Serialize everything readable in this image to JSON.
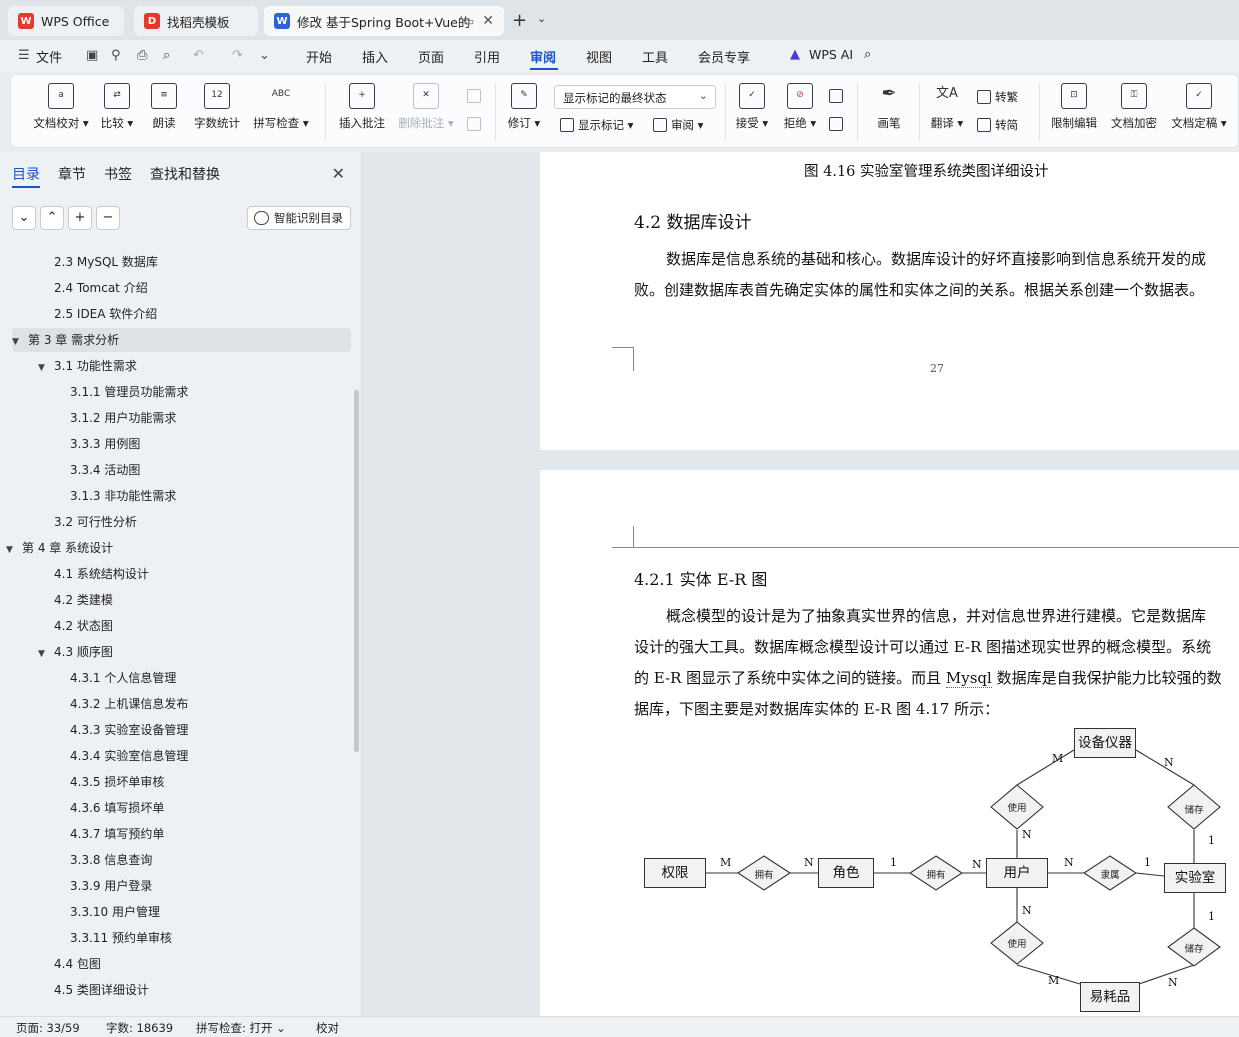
{
  "tabs": [
    {
      "label": "WPS Office",
      "icon": "wps-logo-icon"
    },
    {
      "label": "找稻壳模板",
      "icon": "docer-icon"
    },
    {
      "label": "修改 基于Spring Boot+Vue的",
      "icon": "writer-icon"
    }
  ],
  "menu": {
    "file": "文件",
    "items": [
      "开始",
      "插入",
      "页面",
      "引用",
      "审阅",
      "视图",
      "工具",
      "会员专享"
    ],
    "active": "审阅",
    "ai": "WPS AI"
  },
  "ribbon": {
    "doc_check": "文档校对",
    "compare": "比较",
    "read_aloud": "朗读",
    "word_count": "字数统计",
    "word_count_icon_text": "12",
    "spell_check": "拼写检查",
    "spell_icon_text": "ABC",
    "insert_comment": "插入批注",
    "delete_comment": "删除批注",
    "revise": "修订",
    "markup_combo": "显示标记的最终状态",
    "show_markup": "显示标记",
    "review": "审阅",
    "accept": "接受",
    "reject": "拒绝",
    "pen": "画笔",
    "translate": "翻译",
    "to_traditional": "转繁",
    "to_simplified": "转简",
    "restrict_edit": "限制编辑",
    "encrypt": "文档加密",
    "finalize": "文档定稿"
  },
  "nav": {
    "tabs": [
      "目录",
      "章节",
      "书签",
      "查找和替换"
    ],
    "smart_btn": "智能识别目录",
    "toc": [
      {
        "text": "2.3 MySQL 数据库",
        "level": 2
      },
      {
        "text": "2.4 Tomcat 介绍",
        "level": 2
      },
      {
        "text": "2.5 IDEA 软件介绍",
        "level": 2
      },
      {
        "text": "第 3 章  需求分析",
        "level": 1,
        "expanded": true,
        "selected": true
      },
      {
        "text": "3.1  功能性需求",
        "level": 2,
        "expanded": true
      },
      {
        "text": "3.1.1  管理员功能需求",
        "level": 3
      },
      {
        "text": "3.1.2  用户功能需求",
        "level": 3
      },
      {
        "text": "3.3.3 用例图",
        "level": 3
      },
      {
        "text": "3.3.4 活动图",
        "level": 3
      },
      {
        "text": "3.1.3  非功能性需求",
        "level": 3
      },
      {
        "text": "3.2  可行性分析",
        "level": 2
      },
      {
        "text": "第 4 章  系统设计",
        "level": 1,
        "expanded": true
      },
      {
        "text": "4.1  系统结构设计",
        "level": 2
      },
      {
        "text": "4.2  类建模",
        "level": 2
      },
      {
        "text": "4.2  状态图",
        "level": 2
      },
      {
        "text": "4.3  顺序图",
        "level": 2,
        "expanded": true
      },
      {
        "text": "4.3.1  个人信息管理",
        "level": 3
      },
      {
        "text": "4.3.2 上机课信息发布",
        "level": 3
      },
      {
        "text": "4.3.3 实验室设备管理",
        "level": 3
      },
      {
        "text": "4.3.4 实验室信息管理",
        "level": 3
      },
      {
        "text": "4.3.5 损坏单审核",
        "level": 3
      },
      {
        "text": "4.3.6 填写损坏单",
        "level": 3
      },
      {
        "text": "4.3.7 填写预约单",
        "level": 3
      },
      {
        "text": "3.3.8 信息查询",
        "level": 3
      },
      {
        "text": "3.3.9 用户登录",
        "level": 3
      },
      {
        "text": "3.3.10 用户管理",
        "level": 3
      },
      {
        "text": "3.3.11 预约单审核",
        "level": 3
      },
      {
        "text": "4.4  包图",
        "level": 2
      },
      {
        "text": "4.5 类图详细设计",
        "level": 2
      }
    ]
  },
  "doc": {
    "caption": "图 4.16  实验室管理系统类图详细设计",
    "heading_42": "4.2  数据库设计",
    "para1_line1": "数据库是信息系统的基础和核心。数据库设计的好坏直接影响到信息系统开发的成",
    "para1_line2": "败。创建数据库表首先确定实体的属性和实体之间的关系。根据关系创建一个数据表。",
    "page_number": "27",
    "heading_421": "4.2.1  实体 E-R 图",
    "para2_line1": "概念模型的设计是为了抽象真实世界的信息，并对信息世界进行建模。它是数据库",
    "para2_line2": "设计的强大工具。数据库概念模型设计可以通过 E-R 图描述现实世界的概念模型。系统",
    "para2_line3_a": "的 E-R 图显示了系统中实体之间的链接。而且 ",
    "para2_line3_b": "Mysql",
    "para2_line3_c": " 数据库是自我保护能力比较强的数",
    "para2_line4": "据库，下图主要是对数据库实体的 E-R 图 4.17 所示："
  },
  "er": {
    "entities": {
      "equipment": "设备仪器",
      "permission": "权限",
      "role": "角色",
      "user": "用户",
      "lab": "实验室",
      "consumable": "易耗品"
    },
    "relations": {
      "use1": "使用",
      "store1": "储存",
      "own1": "拥有",
      "own2": "拥有",
      "belong": "隶属",
      "use2": "使用",
      "store2": "储存"
    },
    "cards": {
      "eq_m": "M",
      "eq_n": "N",
      "use1_n": "N",
      "store1_1": "1",
      "perm_m": "M",
      "role_n": "N",
      "role_1": "1",
      "user_n1": "N",
      "user_n2": "N",
      "lab_1": "1",
      "use2_n": "N",
      "store2_1": "1",
      "cons_m": "M",
      "cons_n": "N"
    }
  },
  "status": {
    "page": "页面: 33/59",
    "words": "字数: 18639",
    "spell": "拼写检查: 打开",
    "proof": "校对"
  }
}
